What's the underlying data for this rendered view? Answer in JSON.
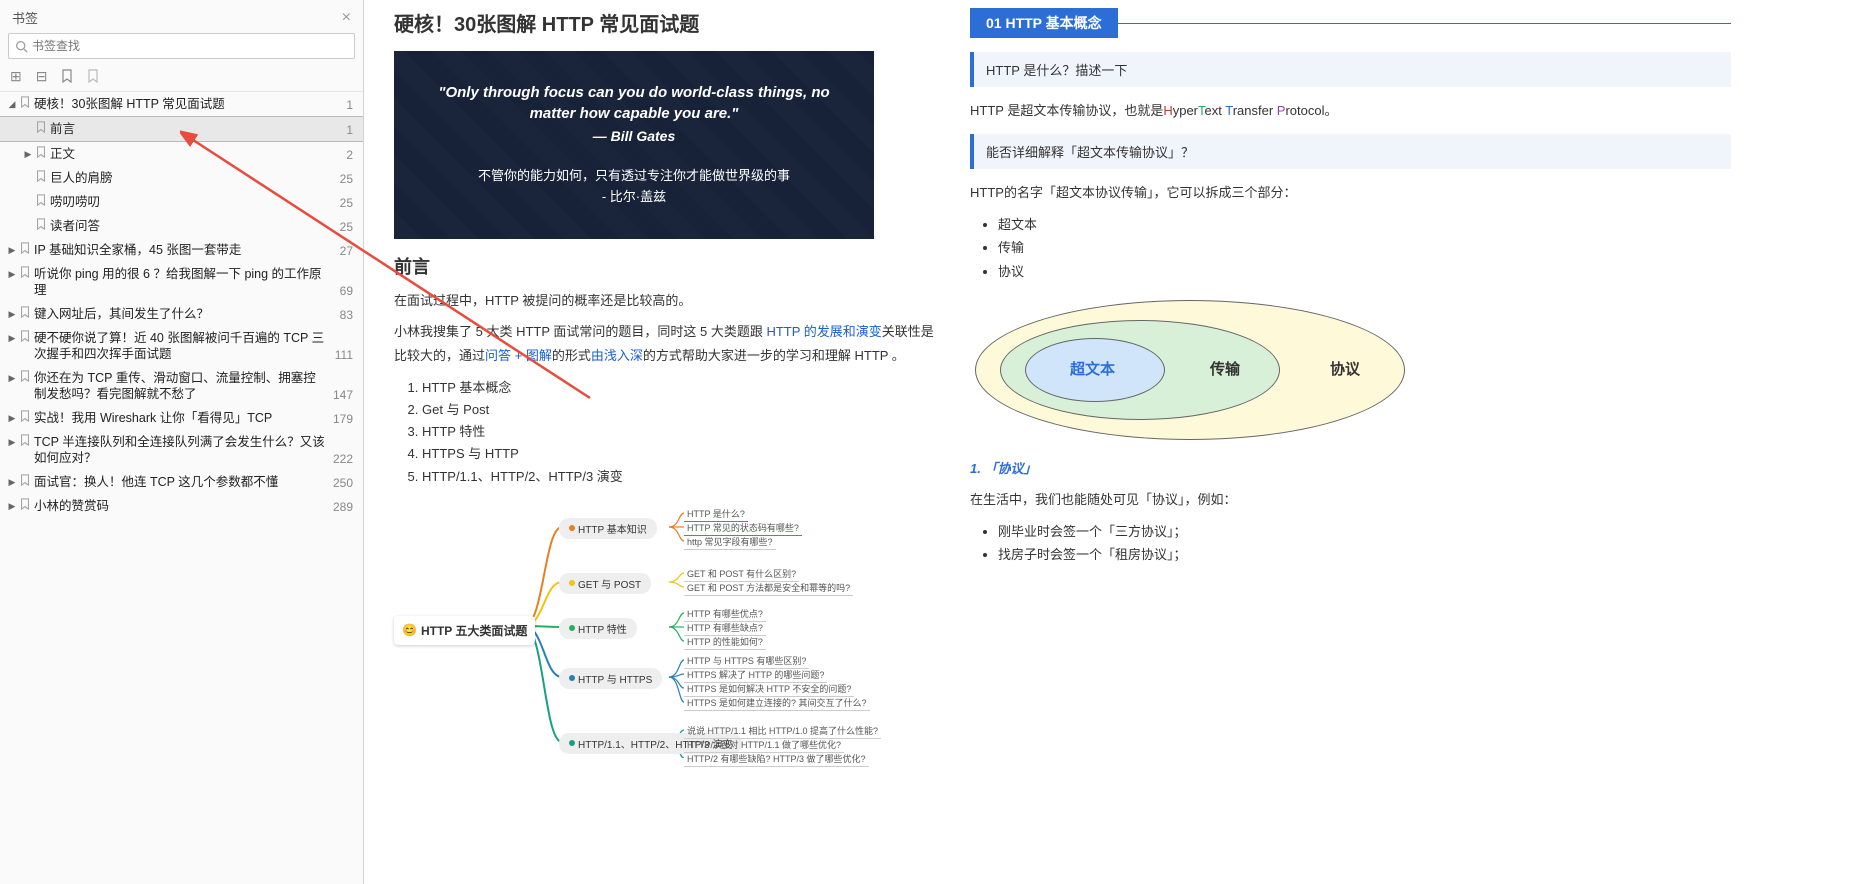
{
  "sidebar": {
    "title": "书签",
    "search_placeholder": "书签查找",
    "tree": [
      {
        "level": 0,
        "chev": "down",
        "label": "硬核！30张图解 HTTP 常见面试题",
        "count": "1",
        "selected": false
      },
      {
        "level": 1,
        "chev": "none",
        "label": "前言",
        "count": "1",
        "selected": true
      },
      {
        "level": 1,
        "chev": "right",
        "label": "正文",
        "count": "2",
        "selected": false
      },
      {
        "level": 1,
        "chev": "none",
        "label": "巨人的肩膀",
        "count": "25",
        "selected": false
      },
      {
        "level": 1,
        "chev": "none",
        "label": "唠叨唠叨",
        "count": "25",
        "selected": false
      },
      {
        "level": 1,
        "chev": "none",
        "label": "读者问答",
        "count": "25",
        "selected": false
      },
      {
        "level": 0,
        "chev": "right",
        "label": "IP 基础知识全家桶，45 张图一套带走",
        "count": "27",
        "selected": false
      },
      {
        "level": 0,
        "chev": "right",
        "label": "听说你 ping 用的很 6 ？给我图解一下 ping 的工作原理",
        "count": "69",
        "selected": false
      },
      {
        "level": 0,
        "chev": "right",
        "label": "键入网址后，其间发生了什么？",
        "count": "83",
        "selected": false
      },
      {
        "level": 0,
        "chev": "right",
        "label": "硬不硬你说了算！近 40 张图解被问千百遍的 TCP 三次握手和四次挥手面试题",
        "count": "111",
        "selected": false
      },
      {
        "level": 0,
        "chev": "right",
        "label": "你还在为 TCP 重传、滑动窗口、流量控制、拥塞控制发愁吗？看完图解就不愁了",
        "count": "147",
        "selected": false
      },
      {
        "level": 0,
        "chev": "right",
        "label": "实战！我用 Wireshark 让你「看得见」TCP",
        "count": "179",
        "selected": false
      },
      {
        "level": 0,
        "chev": "right",
        "label": "TCP 半连接队列和全连接队列满了会发生什么？又该如何应对？",
        "count": "222",
        "selected": false
      },
      {
        "level": 0,
        "chev": "right",
        "label": "面试官：换人！他连 TCP 这几个参数都不懂",
        "count": "250",
        "selected": false
      },
      {
        "level": 0,
        "chev": "right",
        "label": "小林的赞赏码",
        "count": "289",
        "selected": false
      }
    ]
  },
  "article": {
    "title": "硬核！30张图解 HTTP 常见面试题",
    "hero": {
      "quote_en": "\"Only through focus can you do world-class things, no matter how capable you are.\"",
      "author_en": "— Bill Gates",
      "quote_cn": "不管你的能力如何，只有透过专注你才能做世界级的事",
      "author_cn": "- 比尔·盖兹"
    },
    "preface_title": "前言",
    "preface_p1": "在面试过程中，HTTP 被提问的概率还是比较高的。",
    "preface_p2a": "小林我搜集了 5 大类 HTTP 面试常问的题目，同时这 5 大类题跟 ",
    "preface_p2b": "HTTP 的发展和演变",
    "preface_p2c": "关联性是比较大的，通过",
    "preface_p2d": "问答 + 图解",
    "preface_p2e": "的形式",
    "preface_p2f": "由浅入深",
    "preface_p2g": "的方式帮助大家进一步的学习和理解 HTTP 。",
    "ol_items": [
      "HTTP 基本概念",
      "Get 与 Post",
      "HTTP 特性",
      "HTTPS 与 HTTP",
      "HTTP/1.1、HTTP/2、HTTP/3 演变"
    ],
    "mindmap": {
      "root": "HTTP 五大类面试题",
      "branches": [
        {
          "label": "HTTP 基本知识",
          "color": "#e67e22",
          "leaves": [
            "HTTP 是什么?",
            "HTTP 常见的状态码有哪些?",
            "http 常见字段有哪些?"
          ]
        },
        {
          "label": "GET 与 POST",
          "color": "#f1c40f",
          "leaves": [
            "GET 和 POST 有什么区别?",
            "GET 和 POST 方法都是安全和幂等的吗?"
          ]
        },
        {
          "label": "HTTP 特性",
          "color": "#27ae60",
          "leaves": [
            "HTTP 有哪些优点?",
            "HTTP 有哪些缺点?",
            "HTTP 的性能如何?"
          ]
        },
        {
          "label": "HTTP 与 HTTPS",
          "color": "#2980b9",
          "leaves": [
            "HTTP 与 HTTPS 有哪些区别?",
            "HTTPS 解决了 HTTP 的哪些问题?",
            "HTTPS 是如何解决 HTTP 不安全的问题?",
            "HTTPS 是如何建立连接的? 其间交互了什么?"
          ]
        },
        {
          "label": "HTTP/1.1、HTTP/2、HTTP/3 演变",
          "color": "#16a085",
          "leaves": [
            "说说 HTTP/1.1 相比 HTTP/1.0 提高了什么性能?",
            "HTTP/2 针对 HTTP/1.1 做了哪些优化?",
            "HTTP/2 有哪些缺陷? HTTP/3 做了哪些优化?"
          ]
        }
      ]
    }
  },
  "right": {
    "banner": "01 HTTP 基本概念",
    "q1": "HTTP 是什么？描述一下",
    "p1a": "HTTP 是超文本传输协议，也就是",
    "p1_hyper_h": "H",
    "p1_hyper_yper": "yper",
    "p1_hyper_t": "T",
    "p1_hyper_ext": "ext ",
    "p1_hyper_t2": "T",
    "p1_hyper_ransfer": "ransfer ",
    "p1_hyper_p": "P",
    "p1_hyper_rotocol": "rotocol",
    "p1b": "。",
    "q2": "能否详细解释「超文本传输协议」？",
    "p2": "HTTP的名字「超文本协议传输」，它可以拆成三个部分：",
    "list1": [
      "超文本",
      "传输",
      "协议"
    ],
    "venn": {
      "l1": "超文本",
      "l2": "传输",
      "l3": "协议"
    },
    "sub1": "1. 「协议」",
    "p3": "在生活中，我们也能随处可见「协议」，例如：",
    "list2": [
      "刚毕业时会签一个「三方协议」；",
      "找房子时会签一个「租房协议」；"
    ]
  }
}
